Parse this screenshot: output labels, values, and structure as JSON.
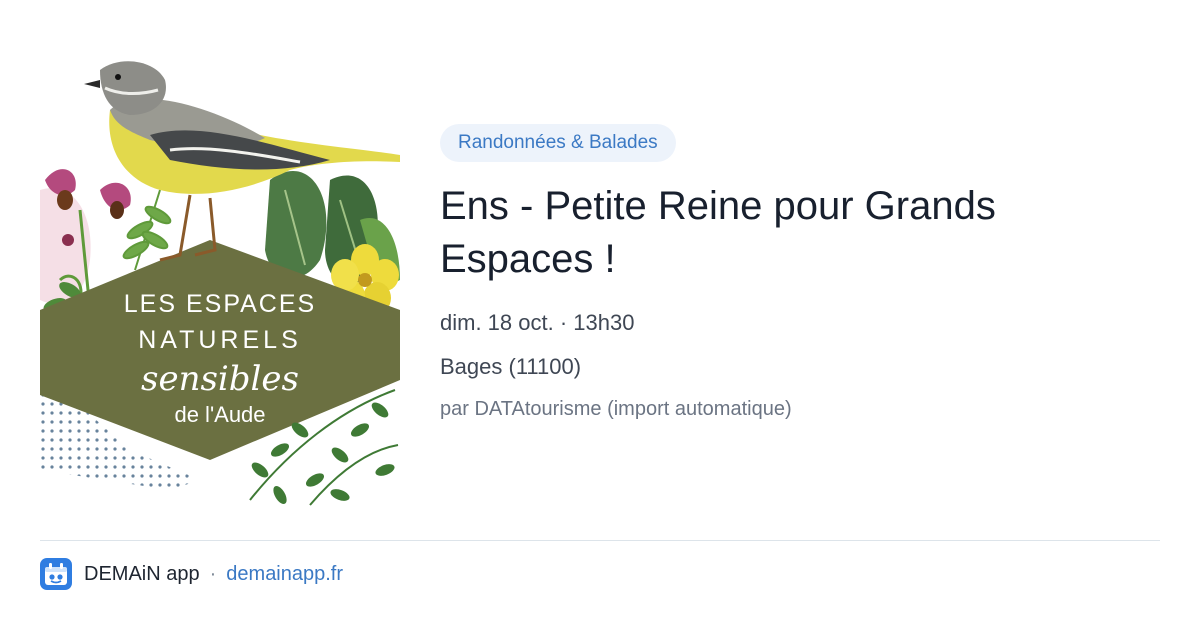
{
  "event": {
    "category": "Randonnées & Balades",
    "title": "Ens - Petite Reine pour Grands Espaces !",
    "datetime": "dim. 18 oct. · 13h30",
    "location": "Bages (11100)",
    "organizer": "par DATAtourisme (import automatique)"
  },
  "hero": {
    "line1": "LES ESPACES",
    "line2": "NATURELS",
    "line3": "sensibles",
    "line4": "de l'Aude",
    "colors": {
      "olive": "#6b7041",
      "leaf": "#5f9a3a",
      "yellow": "#e9d93a",
      "pink": "#b44a7e"
    }
  },
  "footer": {
    "app_name": "DEMAiN app",
    "separator": "·",
    "domain": "demainapp.fr",
    "icon": "demain-app-icon"
  },
  "colors": {
    "accent": "#3b79c4",
    "title": "#18202e",
    "chip_bg": "#edf3fb"
  }
}
